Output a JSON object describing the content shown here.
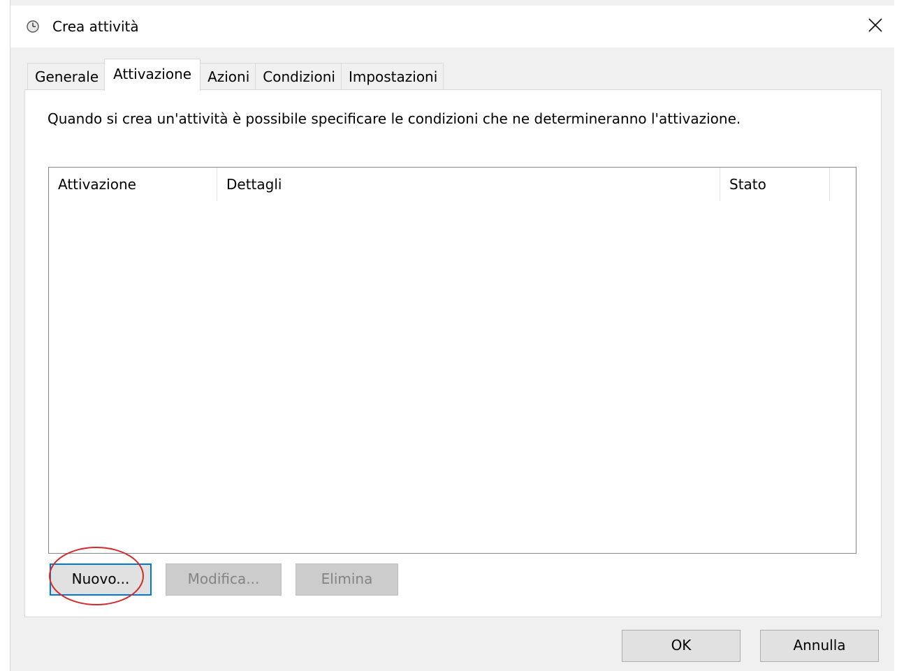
{
  "window": {
    "title": "Crea attività",
    "icon": "clock-icon",
    "close_glyph": "✕"
  },
  "tabs": [
    {
      "label": "Generale",
      "active": false
    },
    {
      "label": "Attivazione",
      "active": true
    },
    {
      "label": "Azioni",
      "active": false
    },
    {
      "label": "Condizioni",
      "active": false
    },
    {
      "label": "Impostazioni",
      "active": false
    }
  ],
  "panel": {
    "description": "Quando si crea un'attività è possibile specificare le condizioni che ne determineranno l'attivazione.",
    "list": {
      "columns": [
        "Attivazione",
        "Dettagli",
        "Stato"
      ],
      "rows": []
    },
    "buttons": {
      "new_label": "Nuovo...",
      "edit_label": "Modifica...",
      "delete_label": "Elimina"
    }
  },
  "dialog_buttons": {
    "ok_label": "OK",
    "cancel_label": "Annulla"
  },
  "colors": {
    "focus_border": "#0078d7",
    "annotation": "#d42a2a",
    "window_bg": "#f0f0f0"
  }
}
